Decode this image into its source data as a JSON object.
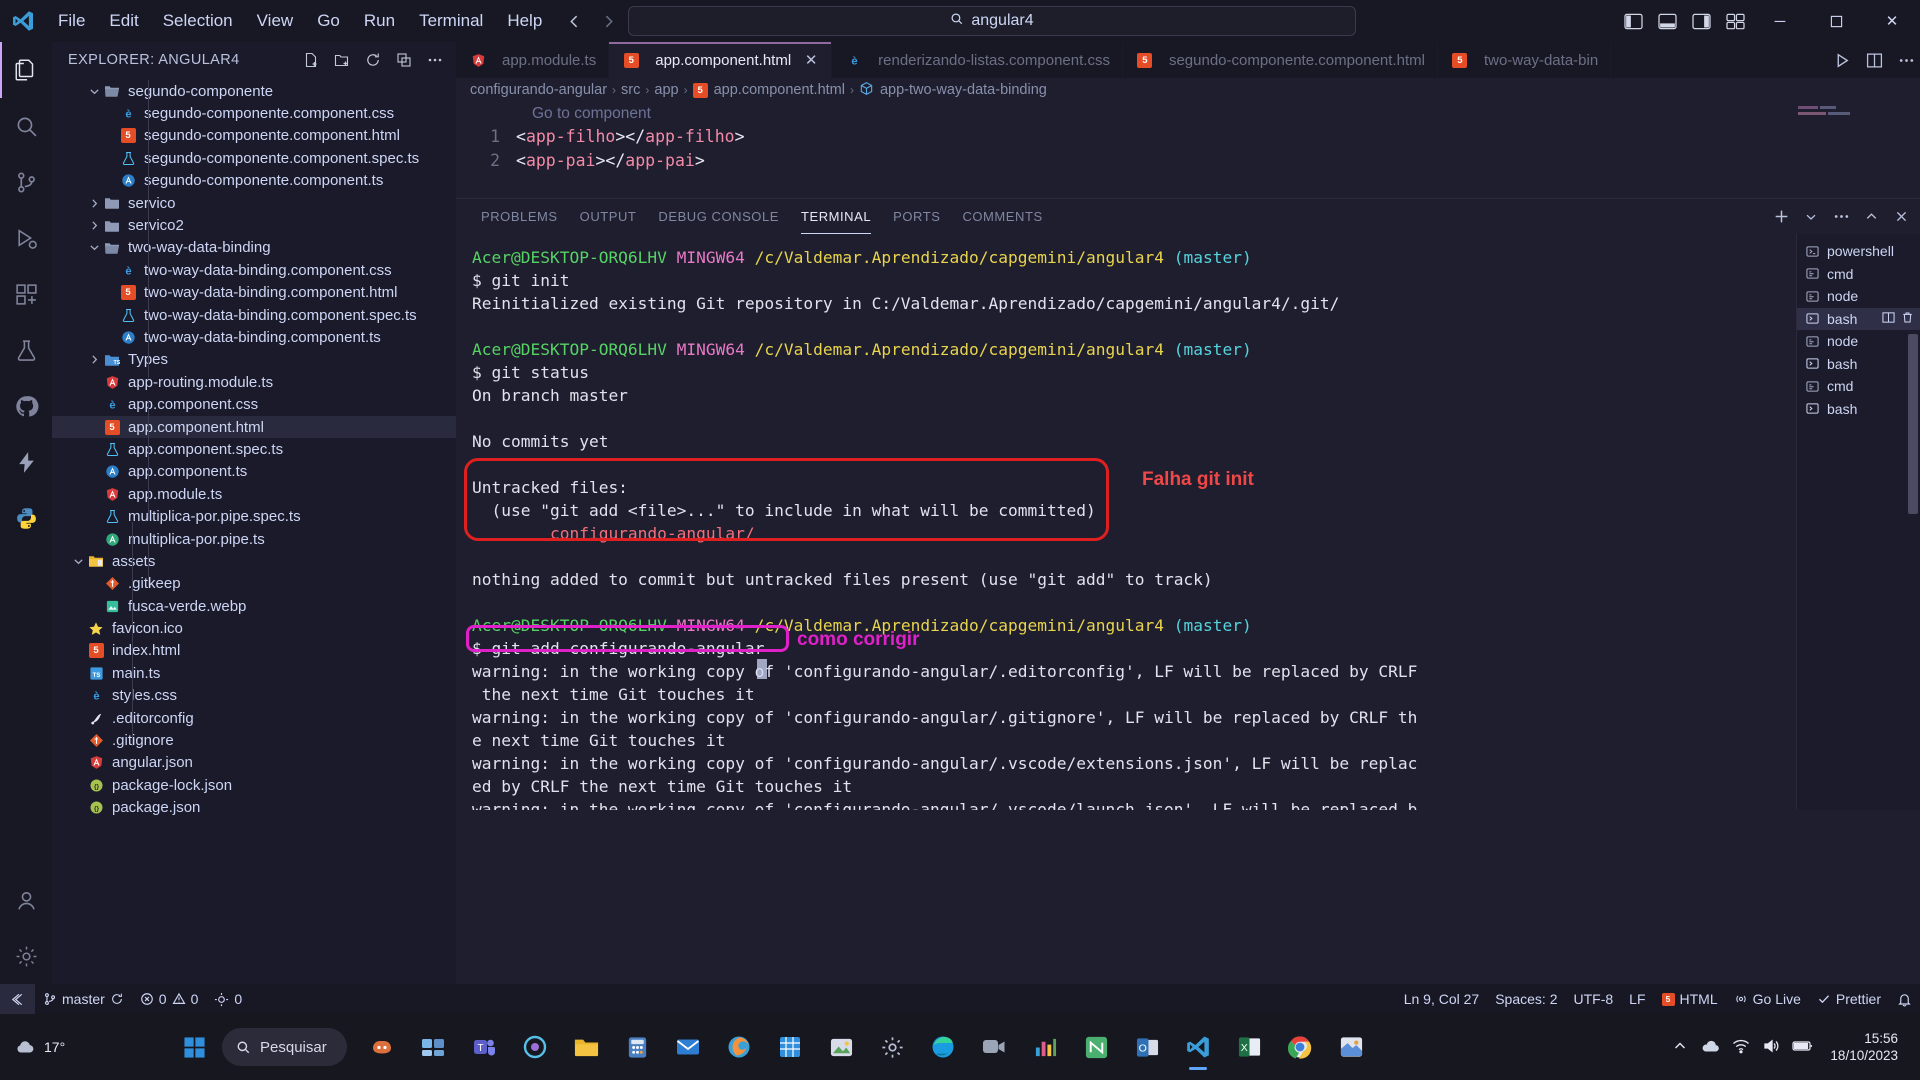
{
  "titlebar": {
    "menus": [
      "File",
      "Edit",
      "Selection",
      "View",
      "Go",
      "Run",
      "Terminal",
      "Help"
    ],
    "command_center_value": "angular4",
    "search_icon": "search-icon",
    "back_icon": "arrow-left-icon",
    "forward_icon": "arrow-right-icon",
    "layout_icons": [
      "toggle-primary-sidebar-icon",
      "toggle-panel-icon",
      "toggle-secondary-sidebar-icon",
      "customize-layout-icon"
    ],
    "window_controls": {
      "minimize": "─",
      "maximize": "☐",
      "close": "✕"
    }
  },
  "activitybar": {
    "items": [
      {
        "name": "explorer",
        "icon": "files-icon",
        "active": true
      },
      {
        "name": "search",
        "icon": "search-icon",
        "active": false
      },
      {
        "name": "source-control",
        "icon": "source-control-icon",
        "active": false
      },
      {
        "name": "run-and-debug",
        "icon": "debug-icon",
        "active": false
      },
      {
        "name": "extensions",
        "icon": "extensions-icon",
        "active": false
      },
      {
        "name": "testing",
        "icon": "beaker-icon",
        "active": false
      },
      {
        "name": "github",
        "icon": "github-icon",
        "active": false
      },
      {
        "name": "thunder-client",
        "icon": "lightning-icon",
        "active": false
      },
      {
        "name": "python",
        "icon": "python-icon",
        "active": false
      }
    ],
    "bottom": [
      {
        "name": "accounts",
        "icon": "account-icon"
      },
      {
        "name": "manage",
        "icon": "gear-icon"
      }
    ]
  },
  "sidebar": {
    "title": "EXPLORER: ANGULAR4",
    "actions": [
      "new-file-icon",
      "new-folder-icon",
      "refresh-icon",
      "collapse-all-icon",
      "more-actions-icon"
    ],
    "tree": [
      {
        "label": "segundo-componente",
        "type": "folder-open",
        "depth": 1,
        "twisty": "down"
      },
      {
        "label": "segundo-componente.component.css",
        "type": "css",
        "depth": 2
      },
      {
        "label": "segundo-componente.component.html",
        "type": "html",
        "depth": 2
      },
      {
        "label": "segundo-componente.component.spec.ts",
        "type": "spec",
        "depth": 2
      },
      {
        "label": "segundo-componente.component.ts",
        "type": "angular-blue",
        "depth": 2
      },
      {
        "label": "servico",
        "type": "folder",
        "depth": 1,
        "twisty": "right"
      },
      {
        "label": "servico2",
        "type": "folder",
        "depth": 1,
        "twisty": "right"
      },
      {
        "label": "two-way-data-binding",
        "type": "folder-open",
        "depth": 1,
        "twisty": "down"
      },
      {
        "label": "two-way-data-binding.component.css",
        "type": "css",
        "depth": 2
      },
      {
        "label": "two-way-data-binding.component.html",
        "type": "html",
        "depth": 2
      },
      {
        "label": "two-way-data-binding.component.spec.ts",
        "type": "spec",
        "depth": 2
      },
      {
        "label": "two-way-data-binding.component.ts",
        "type": "angular-blue",
        "depth": 2
      },
      {
        "label": "Types",
        "type": "folder-ts",
        "depth": 1,
        "twisty": "right"
      },
      {
        "label": "app-routing.module.ts",
        "type": "angular-red",
        "depth": 1
      },
      {
        "label": "app.component.css",
        "type": "css",
        "depth": 1
      },
      {
        "label": "app.component.html",
        "type": "html",
        "depth": 1,
        "selected": true
      },
      {
        "label": "app.component.spec.ts",
        "type": "spec",
        "depth": 1
      },
      {
        "label": "app.component.ts",
        "type": "angular-blue",
        "depth": 1
      },
      {
        "label": "app.module.ts",
        "type": "angular-red",
        "depth": 1
      },
      {
        "label": "multiplica-por.pipe.spec.ts",
        "type": "spec",
        "depth": 1
      },
      {
        "label": "multiplica-por.pipe.ts",
        "type": "angular-green",
        "depth": 1
      },
      {
        "label": "assets",
        "type": "folder-assets",
        "depth": 0,
        "twisty": "down"
      },
      {
        "label": ".gitkeep",
        "type": "git",
        "depth": 1
      },
      {
        "label": "fusca-verde.webp",
        "type": "image",
        "depth": 1
      },
      {
        "label": "favicon.ico",
        "type": "star",
        "depth": 0
      },
      {
        "label": "index.html",
        "type": "html",
        "depth": 0
      },
      {
        "label": "main.ts",
        "type": "ts",
        "depth": 0
      },
      {
        "label": "styles.css",
        "type": "css",
        "depth": 0
      },
      {
        "label": ".editorconfig",
        "type": "editorconfig",
        "depth": 0
      },
      {
        "label": ".gitignore",
        "type": "gitignore",
        "depth": 0
      },
      {
        "label": "angular.json",
        "type": "angular-red",
        "depth": 0
      },
      {
        "label": "package-lock.json",
        "type": "json",
        "depth": 0
      },
      {
        "label": "package.json",
        "type": "json",
        "depth": 0
      }
    ]
  },
  "editor": {
    "tabs": [
      {
        "label": "app.module.ts",
        "icon": "angular-red",
        "active": false,
        "closable": false
      },
      {
        "label": "app.component.html",
        "icon": "html",
        "active": true,
        "closable": true
      },
      {
        "label": "renderizando-listas.component.css",
        "icon": "css",
        "active": false,
        "closable": false
      },
      {
        "label": "segundo-componente.component.html",
        "icon": "html",
        "active": false,
        "closable": false
      },
      {
        "label": "two-way-data-bin",
        "icon": "html",
        "active": false,
        "closable": false
      }
    ],
    "tab_actions": [
      "run-icon",
      "split-editor-icon",
      "more-actions-icon"
    ],
    "close_glyph": "✕",
    "breadcrumb": [
      "configurando-angular",
      "src",
      "app",
      "app.component.html",
      "app-two-way-data-binding"
    ],
    "breadcrumb_file_icon": "html",
    "breadcrumb_symbol_icon": "symbol-package-icon",
    "ghost_hint": "Go to component",
    "lines": [
      {
        "number": "1",
        "tag": "app-filho"
      },
      {
        "number": "2",
        "tag": "app-pai"
      }
    ]
  },
  "panel": {
    "tabs": [
      "PROBLEMS",
      "OUTPUT",
      "DEBUG CONSOLE",
      "TERMINAL",
      "PORTS",
      "COMMENTS"
    ],
    "active_tab": "TERMINAL",
    "actions": [
      "new-terminal-icon",
      "split-dropdown-icon",
      "more-actions-icon",
      "maximize-panel-icon",
      "close-panel-icon"
    ],
    "terminal_list": [
      {
        "name": "powershell",
        "icon": "powershell-icon",
        "active": false
      },
      {
        "name": "cmd",
        "icon": "cmd-icon",
        "active": false
      },
      {
        "name": "node",
        "icon": "cmd-icon",
        "active": false
      },
      {
        "name": "bash",
        "icon": "bash-icon",
        "active": true
      },
      {
        "name": "node",
        "icon": "cmd-icon",
        "active": false
      },
      {
        "name": "bash",
        "icon": "bash-icon",
        "active": false
      },
      {
        "name": "cmd",
        "icon": "cmd-icon",
        "active": false
      },
      {
        "name": "bash",
        "icon": "bash-icon",
        "active": false
      }
    ],
    "terminal_list_row_actions": [
      "split-terminal-icon",
      "kill-terminal-icon"
    ],
    "terminal_lines": [
      {
        "segments": [
          {
            "t": "Acer@DESKTOP-ORQ6LHV ",
            "c": "green"
          },
          {
            "t": "MINGW64 ",
            "c": "magenta"
          },
          {
            "t": "/c/Valdemar.Aprendizado/capgemini/angular4 ",
            "c": "yellow"
          },
          {
            "t": "(master)",
            "c": "cyan"
          }
        ]
      },
      {
        "segments": [
          {
            "t": "$ git init",
            "c": "white"
          }
        ]
      },
      {
        "segments": [
          {
            "t": "Reinitialized existing Git repository in C:/Valdemar.Aprendizado/capgemini/angular4/.git/",
            "c": "white"
          }
        ]
      },
      {
        "segments": [
          {
            "t": "",
            "c": "white"
          }
        ]
      },
      {
        "segments": [
          {
            "t": "Acer@DESKTOP-ORQ6LHV ",
            "c": "green"
          },
          {
            "t": "MINGW64 ",
            "c": "magenta"
          },
          {
            "t": "/c/Valdemar.Aprendizado/capgemini/angular4 ",
            "c": "yellow"
          },
          {
            "t": "(master)",
            "c": "cyan"
          }
        ]
      },
      {
        "segments": [
          {
            "t": "$ git status",
            "c": "white"
          }
        ]
      },
      {
        "segments": [
          {
            "t": "On branch master",
            "c": "white"
          }
        ]
      },
      {
        "segments": [
          {
            "t": "",
            "c": "white"
          }
        ]
      },
      {
        "segments": [
          {
            "t": "No commits yet",
            "c": "white"
          }
        ]
      },
      {
        "segments": [
          {
            "t": "",
            "c": "white"
          }
        ]
      },
      {
        "segments": [
          {
            "t": "Untracked files:",
            "c": "white"
          }
        ]
      },
      {
        "segments": [
          {
            "t": "  (use \"git add <file>...\" to include in what will be committed)",
            "c": "white"
          }
        ]
      },
      {
        "segments": [
          {
            "t": "        configurando-angular/",
            "c": "red"
          }
        ]
      },
      {
        "segments": [
          {
            "t": "",
            "c": "white"
          }
        ]
      },
      {
        "segments": [
          {
            "t": "nothing added to commit but untracked files present (use \"git add\" to track)",
            "c": "white"
          }
        ]
      },
      {
        "segments": [
          {
            "t": "",
            "c": "white"
          }
        ]
      },
      {
        "segments": [
          {
            "t": "Acer@DESKTOP-ORQ6LHV ",
            "c": "green"
          },
          {
            "t": "MINGW64 ",
            "c": "magenta"
          },
          {
            "t": "/c/Valdemar.Aprendizado/capgemini/angular4 ",
            "c": "yellow"
          },
          {
            "t": "(master)",
            "c": "cyan"
          }
        ]
      },
      {
        "segments": [
          {
            "t": "$ git add configurando-angular",
            "c": "white"
          }
        ]
      },
      {
        "segments": [
          {
            "t": "warning: in the working copy of 'configurando-angular/.editorconfig', LF will be replaced by CRLF",
            "c": "white"
          }
        ]
      },
      {
        "segments": [
          {
            "t": " the next time Git touches it",
            "c": "white"
          }
        ]
      },
      {
        "segments": [
          {
            "t": "warning: in the working copy of 'configurando-angular/.gitignore', LF will be replaced by CRLF th",
            "c": "white"
          }
        ]
      },
      {
        "segments": [
          {
            "t": "e next time Git touches it",
            "c": "white"
          }
        ]
      },
      {
        "segments": [
          {
            "t": "warning: in the working copy of 'configurando-angular/.vscode/extensions.json', LF will be replac",
            "c": "white"
          }
        ]
      },
      {
        "segments": [
          {
            "t": "ed by CRLF the next time Git touches it",
            "c": "white"
          }
        ]
      },
      {
        "segments": [
          {
            "t": "warning: in the working copy of 'configurando-angular/.vscode/launch.json', LF will be replaced b",
            "c": "white"
          }
        ]
      }
    ]
  },
  "annotations": [
    {
      "name": "falha-git-init-label",
      "text": "Falha git init",
      "color": "#f04747"
    },
    {
      "name": "como-corrigir-label",
      "text": "como corrigir",
      "color": "#e020c8"
    }
  ],
  "statusbar": {
    "remote_icon": "remote-window-icon",
    "branch_icon": "source-control-icon",
    "branch": "master",
    "sync_icon": "sync-icon",
    "errors_icon": "error-icon",
    "errors": "0",
    "warnings_icon": "warning-icon",
    "warnings": "0",
    "ports_icon": "ports-icon",
    "ports": "0",
    "cursor": "Ln 9, Col 27",
    "spaces": "Spaces: 2",
    "encoding": "UTF-8",
    "eol": "LF",
    "language_icon": "html-icon",
    "language": "HTML",
    "golive_icon": "broadcast-icon",
    "golive": "Go Live",
    "prettier_icon": "check-icon",
    "prettier": "Prettier",
    "bell_icon": "bell-icon"
  },
  "taskbar": {
    "weather_temp": "17°",
    "weather_icon": "cloud-icon",
    "start_icon": "windows-start-icon",
    "search_placeholder": "Pesquisar",
    "search_icon": "search-icon",
    "apps": [
      {
        "name": "copilot",
        "icon": "copilot-icon"
      },
      {
        "name": "task-view",
        "icon": "task-view-icon"
      },
      {
        "name": "teams",
        "icon": "teams-icon"
      },
      {
        "name": "edge-dev",
        "icon": "edge-dev-icon"
      },
      {
        "name": "file-explorer",
        "icon": "folder-icon"
      },
      {
        "name": "calculator",
        "icon": "calculator-icon"
      },
      {
        "name": "mail",
        "icon": "mail-icon"
      },
      {
        "name": "firefox",
        "icon": "firefox-icon"
      },
      {
        "name": "excel-online",
        "icon": "grid-icon"
      },
      {
        "name": "photos",
        "icon": "photos-icon"
      },
      {
        "name": "settings",
        "icon": "settings-icon"
      },
      {
        "name": "edge",
        "icon": "edge-icon"
      },
      {
        "name": "zoom",
        "icon": "zoom-icon"
      },
      {
        "name": "charts-app",
        "icon": "charts-icon"
      },
      {
        "name": "notion",
        "icon": "notion-icon"
      },
      {
        "name": "outlook",
        "icon": "outlook-icon"
      },
      {
        "name": "vscode",
        "icon": "vscode-icon",
        "active": true
      },
      {
        "name": "excel",
        "icon": "excel-icon"
      },
      {
        "name": "chrome",
        "icon": "chrome-icon"
      },
      {
        "name": "paint",
        "icon": "paint-icon"
      }
    ],
    "tray_icons": [
      "chevron-up-icon",
      "onedrive-icon",
      "wifi-icon",
      "volume-icon",
      "battery-icon"
    ],
    "clock_time": "15:56",
    "clock_date": "18/10/2023"
  }
}
